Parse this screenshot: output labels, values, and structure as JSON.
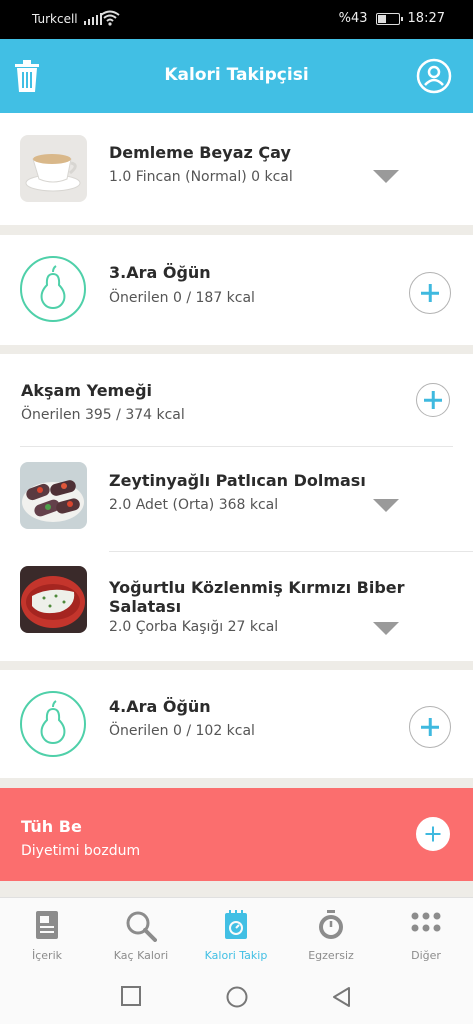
{
  "status": {
    "carrier": "Turkcell",
    "battery": "%43",
    "battery_level": 0.43,
    "time": "18:27"
  },
  "appbar": {
    "title": "Kalori Takipçisi",
    "left_icon": "trash-icon",
    "right_icon": "profile-icon"
  },
  "entries": {
    "tea": {
      "name": "Demleme Beyaz Çay",
      "detail": "1.0 Fincan (Normal) 0 kcal"
    },
    "snack3": {
      "title": "3.Ara Öğün",
      "detail": "Önerilen 0 / 187 kcal"
    },
    "dinner": {
      "title": "Akşam Yemeği",
      "detail": "Önerilen 395 / 374 kcal",
      "items": [
        {
          "name": "Zeytinyağlı Patlıcan Dolması",
          "detail": "2.0 Adet (Orta) 368 kcal"
        },
        {
          "name": "Yoğurtlu Közlenmiş Kırmızı Biber Salatası",
          "detail": "2.0 Çorba Kaşığı 27 kcal"
        }
      ]
    },
    "snack4": {
      "title": "4.Ara Öğün",
      "detail": "Önerilen 0 / 102 kcal"
    },
    "cheat": {
      "title": "Tüh Be",
      "detail": "Diyetimi bozdum"
    }
  },
  "nav": {
    "items": [
      {
        "label": "İçerik",
        "icon": "document-icon"
      },
      {
        "label": "Kaç Kalori",
        "icon": "search-icon"
      },
      {
        "label": "Kalori Takip",
        "icon": "calorie-tracker-icon"
      },
      {
        "label": "Egzersiz",
        "icon": "stopwatch-icon"
      },
      {
        "label": "Diğer",
        "icon": "more-icon"
      }
    ],
    "active": "Kalori Takip"
  },
  "colors": {
    "accent": "#41bfe4",
    "pear": "#4fd0a9",
    "cheat": "#fb6e6e"
  }
}
